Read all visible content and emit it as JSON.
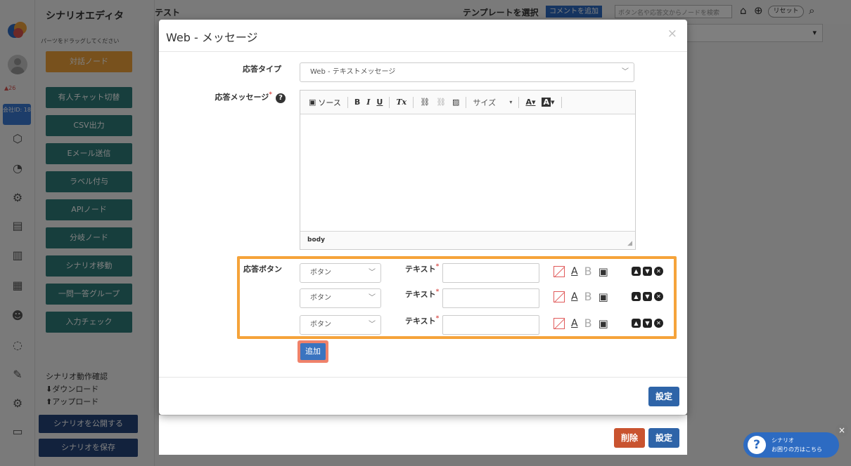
{
  "background": {
    "palette_title": "シナリオエディタ",
    "palette_hint": "パーツをドラッグしてください",
    "node_buttons": [
      "対話ノード",
      "有人チャット切替",
      "CSV出力",
      "Eメール送信",
      "ラベル付与",
      "APIノード",
      "分岐ノード",
      "シナリオ移動",
      "一問一答グループ",
      "入力チェック"
    ],
    "scenario_check": "シナリオ動作確認",
    "download": "ダウンロード",
    "upload": "アップロード",
    "publish": "シナリオを公開する",
    "save": "シナリオを保存",
    "badge_count": "26",
    "company_id": "会社ID: 18",
    "scenario_name": "テスト",
    "template_select": "テンプレートを選択",
    "add_comment": "コメントを追加",
    "search_placeholder": "ボタン名や応答文からノードを検索",
    "reset": "リセット"
  },
  "modal": {
    "title": "Web - メッセージ",
    "close": "×",
    "response_type_label": "応答タイプ",
    "response_type_value": "Web - テキストメッセージ",
    "response_message_label": "応答メッセージ",
    "required_mark": "*",
    "help": "?",
    "editor": {
      "source": "ソース",
      "bold": "B",
      "italic": "I",
      "underline": "U",
      "clear": "Tx",
      "size": "サイズ",
      "text_color": "A",
      "bg_color": "A",
      "path": "body"
    },
    "buttons_label": "応答ボタン",
    "button_rows": [
      {
        "type": "ボタン",
        "text_label": "テキスト",
        "text_value": ""
      },
      {
        "type": "ボタン",
        "text_label": "テキスト",
        "text_value": ""
      },
      {
        "type": "ボタン",
        "text_label": "テキスト",
        "text_value": ""
      }
    ],
    "add": "追加",
    "set": "設定"
  },
  "footer": {
    "delete": "削除",
    "set": "設定"
  },
  "help_widget": {
    "line1": "シナリオ",
    "line2": "お困りの方はこちら",
    "icon": "?",
    "close": "×"
  }
}
